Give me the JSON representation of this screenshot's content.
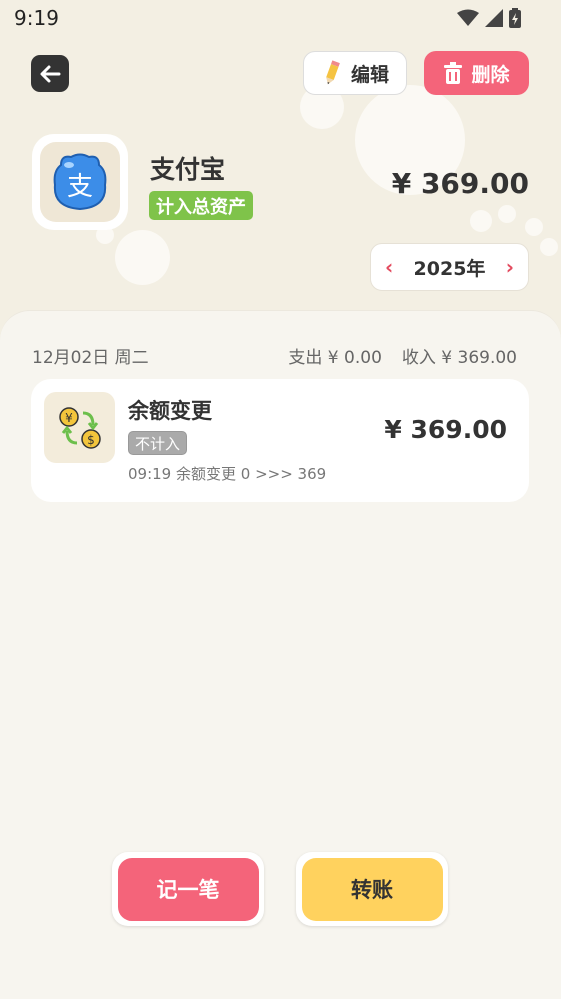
{
  "status_bar": {
    "time": "9:19"
  },
  "header": {
    "edit_label": "编辑",
    "delete_label": "删除"
  },
  "account": {
    "name": "支付宝",
    "icon_char": "支",
    "asset_tag": "计入总资产",
    "balance": "¥ 369.00"
  },
  "year_selector": {
    "year": "2025年"
  },
  "day_group": {
    "date": "12月02日 周二",
    "expense": "支出 ¥ 0.00",
    "income": "收入 ¥ 369.00"
  },
  "records": [
    {
      "title": "余额变更",
      "tag": "不计入",
      "detail": "09:19  余额变更  0  >>>  369",
      "amount": "¥ 369.00"
    }
  ],
  "actions": {
    "record_label": "记一笔",
    "transfer_label": "转账"
  },
  "colors": {
    "accent_red": "#f4647a",
    "accent_yellow": "#ffd25e",
    "tag_green": "#7fc34a"
  }
}
